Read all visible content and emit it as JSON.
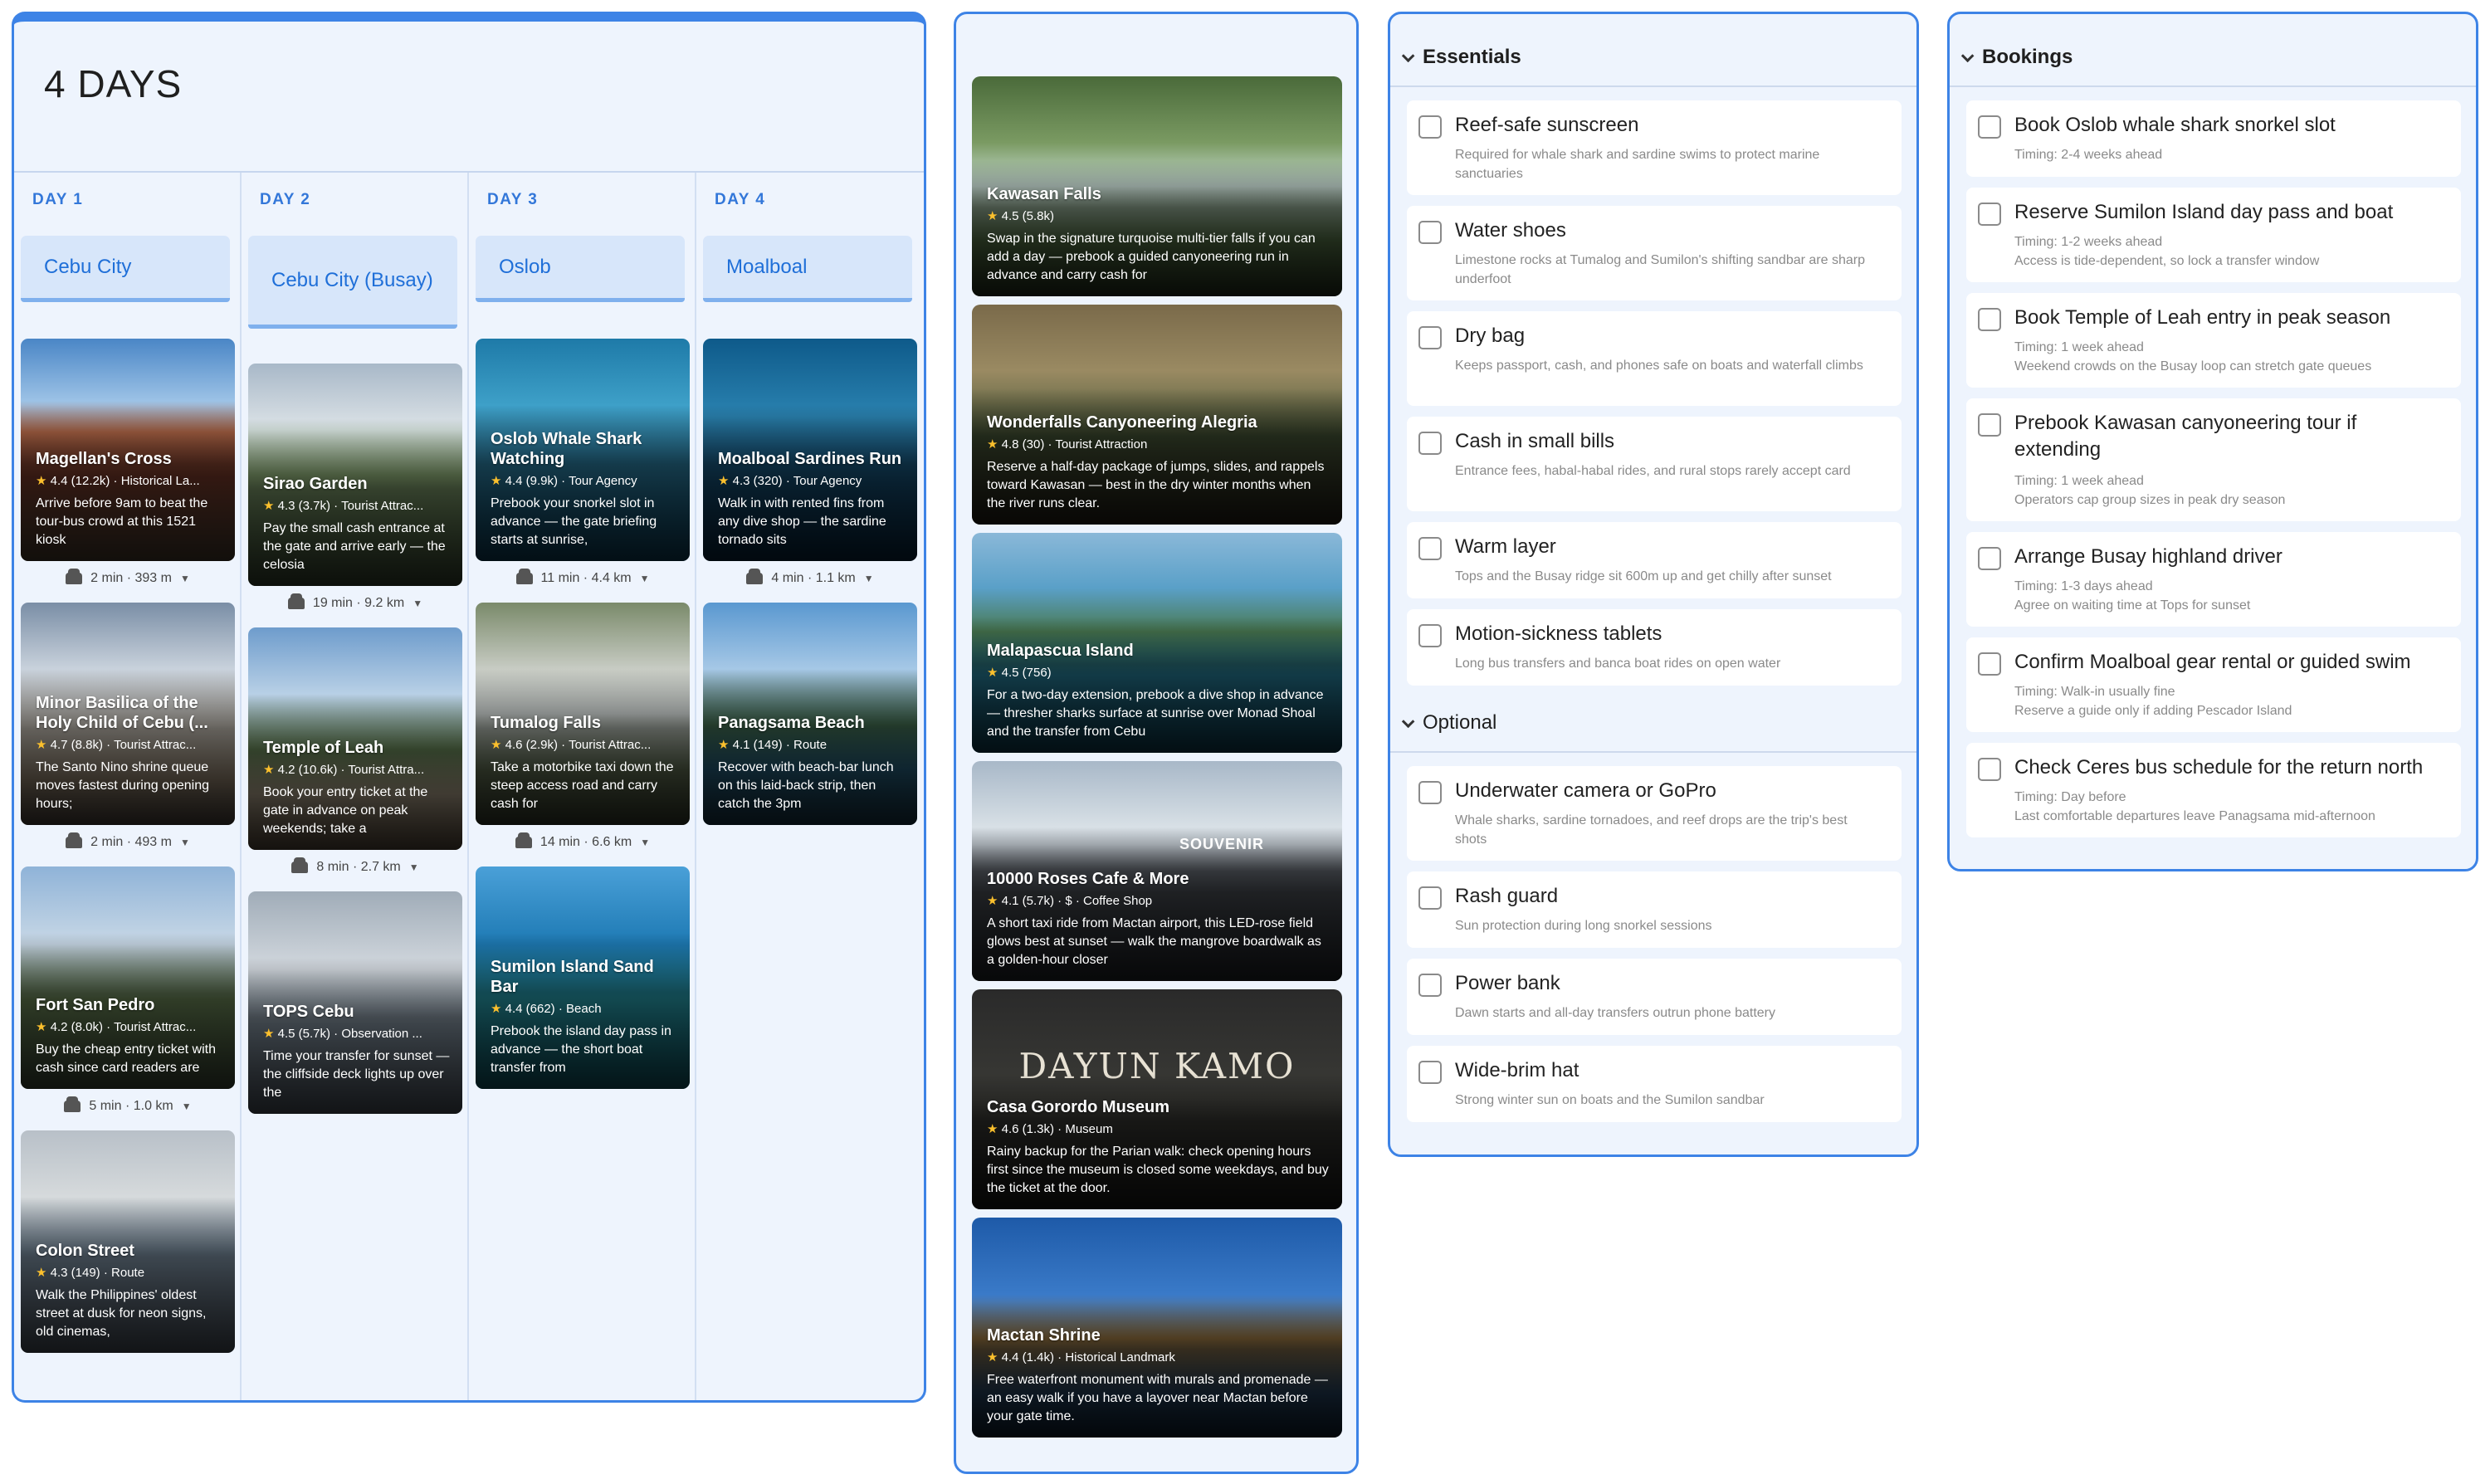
{
  "itinerary": {
    "title": "4 DAYS",
    "days": [
      {
        "label": "DAY 1",
        "city": "Cebu City",
        "places": [
          {
            "name": "Magellan's Cross",
            "rating": "4.4",
            "reviews": "(12.2k)",
            "category": "Historical La...",
            "desc": "Arrive before 9am to beat the tour-bus crowd at this 1521 kiosk",
            "travel": "2 min · 393 m"
          },
          {
            "name": "Minor Basilica of the Holy Child of Cebu (...",
            "rating": "4.7",
            "reviews": "(8.8k)",
            "category": "Tourist Attrac...",
            "desc": "The Santo Nino shrine queue moves fastest during opening hours;",
            "travel": "2 min · 493 m"
          },
          {
            "name": "Fort San Pedro",
            "rating": "4.2",
            "reviews": "(8.0k)",
            "category": "Tourist Attrac...",
            "desc": "Buy the cheap entry ticket with cash since card readers are",
            "travel": "5 min · 1.0 km"
          },
          {
            "name": "Colon Street",
            "rating": "4.3",
            "reviews": "(149)",
            "category": "Route",
            "desc": "Walk the Philippines' oldest street at dusk for neon signs, old cinemas,",
            "travel": ""
          }
        ]
      },
      {
        "label": "DAY 2",
        "city": "Cebu City (Busay)",
        "places": [
          {
            "name": "Sirao Garden",
            "rating": "4.3",
            "reviews": "(3.7k)",
            "category": "Tourist Attrac...",
            "desc": "Pay the small cash entrance at the gate and arrive early — the celosia",
            "travel": "19 min · 9.2 km"
          },
          {
            "name": "Temple of Leah",
            "rating": "4.2",
            "reviews": "(10.6k)",
            "category": "Tourist Attra...",
            "desc": "Book your entry ticket at the gate in advance on peak weekends; take a",
            "travel": "8 min · 2.7 km"
          },
          {
            "name": "TOPS Cebu",
            "rating": "4.5",
            "reviews": "(5.7k)",
            "category": "Observation ...",
            "desc": "Time your transfer for sunset — the cliffside deck lights up over the",
            "travel": ""
          }
        ]
      },
      {
        "label": "DAY 3",
        "city": "Oslob",
        "places": [
          {
            "name": "Oslob Whale Shark Watching",
            "rating": "4.4",
            "reviews": "(9.9k)",
            "category": "Tour Agency",
            "desc": "Prebook your snorkel slot in advance — the gate briefing starts at sunrise,",
            "travel": "11 min · 4.4 km"
          },
          {
            "name": "Tumalog Falls",
            "rating": "4.6",
            "reviews": "(2.9k)",
            "category": "Tourist Attrac...",
            "desc": "Take a motorbike taxi down the steep access road and carry cash for",
            "travel": "14 min · 6.6 km"
          },
          {
            "name": "Sumilon Island Sand Bar",
            "rating": "4.4",
            "reviews": "(662)",
            "category": "Beach",
            "desc": "Prebook the island day pass in advance — the short boat transfer from",
            "travel": ""
          }
        ]
      },
      {
        "label": "DAY 4",
        "city": "Moalboal",
        "places": [
          {
            "name": "Moalboal Sardines Run",
            "rating": "4.3",
            "reviews": "(320)",
            "category": "Tour Agency",
            "desc": "Walk in with rented fins from any dive shop — the sardine tornado sits",
            "travel": "4 min · 1.1 km"
          },
          {
            "name": "Panagsama Beach",
            "rating": "4.1",
            "reviews": "(149)",
            "category": "Route",
            "desc": "Recover with beach-bar lunch on this laid-back strip, then catch the 3pm",
            "travel": ""
          }
        ]
      }
    ]
  },
  "suggestions": [
    {
      "name": "Kawasan Falls",
      "rating": "4.5",
      "reviews": "(5.8k)",
      "category": "",
      "desc": "Swap in the signature turquoise multi-tier falls if you can add a day — prebook a guided canyoneering run in advance and carry cash for"
    },
    {
      "name": "Wonderfalls Canyoneering Alegria",
      "rating": "4.8",
      "reviews": "(30)",
      "category": "Tourist Attraction",
      "desc": "Reserve a half-day package of jumps, slides, and rappels toward Kawasan — best in the dry winter months when the river runs clear."
    },
    {
      "name": "Malapascua Island",
      "rating": "4.5",
      "reviews": "(756)",
      "category": "",
      "desc": "For a two-day extension, prebook a dive shop in advance — thresher sharks surface at sunrise over Monad Shoal and the transfer from Cebu"
    },
    {
      "name": "10000 Roses Cafe & More",
      "rating": "4.1",
      "reviews": "(5.7k)",
      "category": "$ · Coffee Shop",
      "desc": "A short taxi ride from Mactan airport, this LED-rose field glows best at sunset — walk the mangrove boardwalk as a golden-hour closer",
      "sign": "SOUVENIR"
    },
    {
      "name": "Casa Gorordo Museum",
      "rating": "4.6",
      "reviews": "(1.3k)",
      "category": "Museum",
      "desc": "Rainy backup for the Parian walk: check opening hours first since the museum is closed some weekdays, and buy the ticket at the door.",
      "sign": "DAYUN KAMO"
    },
    {
      "name": "Mactan Shrine",
      "rating": "4.4",
      "reviews": "(1.4k)",
      "category": "Historical Landmark",
      "desc": "Free waterfront monument with murals and promenade — an easy walk if you have a layover near Mactan before your gate time."
    }
  ],
  "essentials": {
    "title": "Essentials",
    "items": [
      {
        "title": "Reef-safe sunscreen",
        "sub": "Required for whale shark and sardine swims to protect marine sanctuaries"
      },
      {
        "title": "Water shoes",
        "sub": "Limestone rocks at Tumalog and Sumilon's shifting sandbar are sharp underfoot"
      },
      {
        "title": "Dry bag",
        "sub": "Keeps passport, cash, and phones safe on boats and waterfall climbs"
      },
      {
        "title": "Cash in small bills",
        "sub": "Entrance fees, habal-habal rides, and rural stops rarely accept card"
      },
      {
        "title": "Warm layer",
        "sub": "Tops and the Busay ridge sit 600m up and get chilly after sunset"
      },
      {
        "title": "Motion-sickness tablets",
        "sub": "Long bus transfers and banca boat rides on open water"
      }
    ]
  },
  "optional": {
    "title": "Optional",
    "items": [
      {
        "title": "Underwater camera or GoPro",
        "sub": "Whale sharks, sardine tornadoes, and reef drops are the trip's best shots"
      },
      {
        "title": "Rash guard",
        "sub": "Sun protection during long snorkel sessions"
      },
      {
        "title": "Power bank",
        "sub": "Dawn starts and all-day transfers outrun phone battery"
      },
      {
        "title": "Wide-brim hat",
        "sub": "Strong winter sun on boats and the Sumilon sandbar"
      }
    ]
  },
  "bookings": {
    "title": "Bookings",
    "items": [
      {
        "title": "Book Oslob whale shark snorkel slot",
        "timing": "Timing: 2-4 weeks ahead",
        "note": ""
      },
      {
        "title": "Reserve Sumilon Island day pass and boat",
        "timing": "Timing: 1-2 weeks ahead",
        "note": "Access is tide-dependent, so lock a transfer window"
      },
      {
        "title": "Book Temple of Leah entry in peak season",
        "timing": "Timing: 1 week ahead",
        "note": "Weekend crowds on the Busay loop can stretch gate queues"
      },
      {
        "title": "Prebook Kawasan canyoneering tour if extending",
        "timing": "Timing: 1 week ahead",
        "note": "Operators cap group sizes in peak dry season"
      },
      {
        "title": "Arrange Busay highland driver",
        "timing": "Timing: 1-3 days ahead",
        "note": "Agree on waiting time at Tops for sunset"
      },
      {
        "title": "Confirm Moalboal gear rental or guided swim",
        "timing": "Timing: Walk-in usually fine",
        "note": "Reserve a guide only if adding Pescador Island"
      },
      {
        "title": "Check Ceres bus schedule for the return north",
        "timing": "Timing: Day before",
        "note": "Last comfortable departures leave Panagsama mid-afternoon"
      }
    ]
  },
  "colors": {
    "accent": "#3d83e6",
    "panel_bg": "#eef4fd",
    "day_label": "#3377d9"
  }
}
